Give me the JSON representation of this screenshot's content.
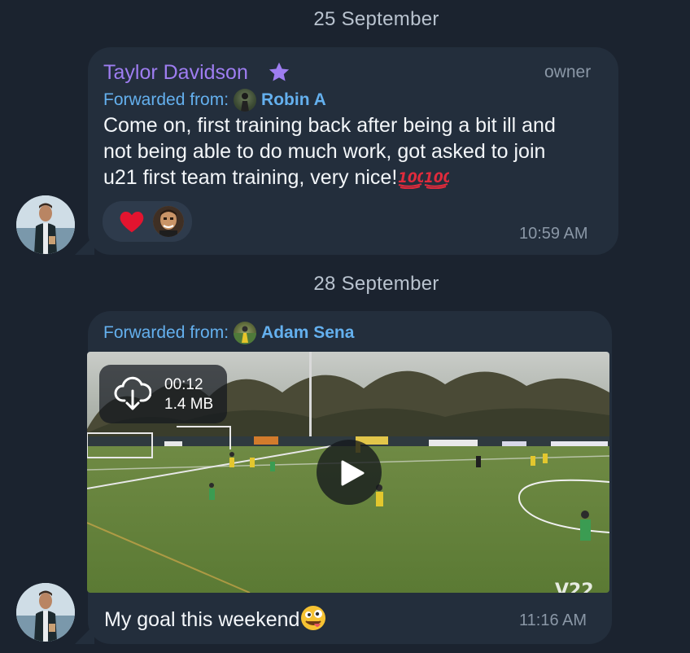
{
  "date_separators": [
    "25 September",
    "28 September"
  ],
  "messages": [
    {
      "sender": "Taylor Davidson",
      "sender_color": "#9e7df1",
      "role": "owner",
      "forwarded_label": "Forwarded from:",
      "forwarded_from": "Robin A",
      "text": "Come on, first training back after being a bit ill and not being able to do much work, got asked to join u21 first team training, very nice!",
      "text_lines": [
        "Come on, first training back after being a bit ill and",
        "not being able to do much work, got asked to join",
        "u21 first team training, very nice!"
      ],
      "text_emojis": [
        "hundred-points-icon",
        "hundred-points-icon"
      ],
      "reactions": [
        {
          "icon": "red-heart-icon",
          "reactor": "avatar"
        }
      ],
      "time": "10:59 AM"
    },
    {
      "forwarded_label": "Forwarded from:",
      "forwarded_from": "Adam Sena",
      "video": {
        "duration": "00:12",
        "size": "1.4 MB",
        "download_icon": "cloud-download-icon",
        "play_icon": "play-icon"
      },
      "caption": "My goal this weekend",
      "caption_emoji": "zany-face-icon",
      "time": "11:16 AM"
    }
  ],
  "colors": {
    "background": "#1b232f",
    "bubble": "#232e3c",
    "link": "#64b0ee",
    "muted": "#8a97a6",
    "accent_star": "#9e7df1"
  }
}
